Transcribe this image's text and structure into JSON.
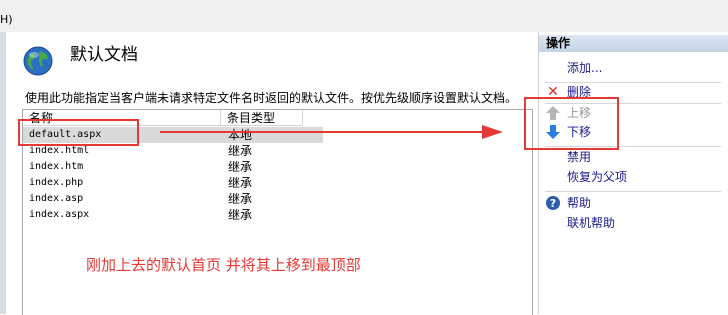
{
  "menubar": {
    "help_fragment": "H)"
  },
  "page": {
    "title": "默认文档",
    "description": "使用此功能指定当客户端未请求特定文件名时返回的默认文件。按优先级顺序设置默认文档。"
  },
  "list": {
    "columns": [
      "名称",
      "条目类型"
    ],
    "rows": [
      {
        "name": "default.aspx",
        "type": "本地",
        "selected": true
      },
      {
        "name": "index.html",
        "type": "继承"
      },
      {
        "name": "index.htm",
        "type": "继承"
      },
      {
        "name": "index.php",
        "type": "继承"
      },
      {
        "name": "index.asp",
        "type": "继承"
      },
      {
        "name": "index.aspx",
        "type": "继承"
      }
    ]
  },
  "annotation": {
    "note": "刚加上去的默认首页 并将其上移到最顶部",
    "color": "#e53935"
  },
  "actions": {
    "header": "操作",
    "add": "添加...",
    "remove": "删除",
    "move_up": "上移",
    "move_down": "下移",
    "disable": "禁用",
    "revert": "恢复为父项",
    "help": "帮助",
    "online_help": "联机帮助"
  },
  "colors": {
    "link": "#1a1a8c",
    "accent_red": "#e53935",
    "header_bg": "#c5d3e6"
  }
}
